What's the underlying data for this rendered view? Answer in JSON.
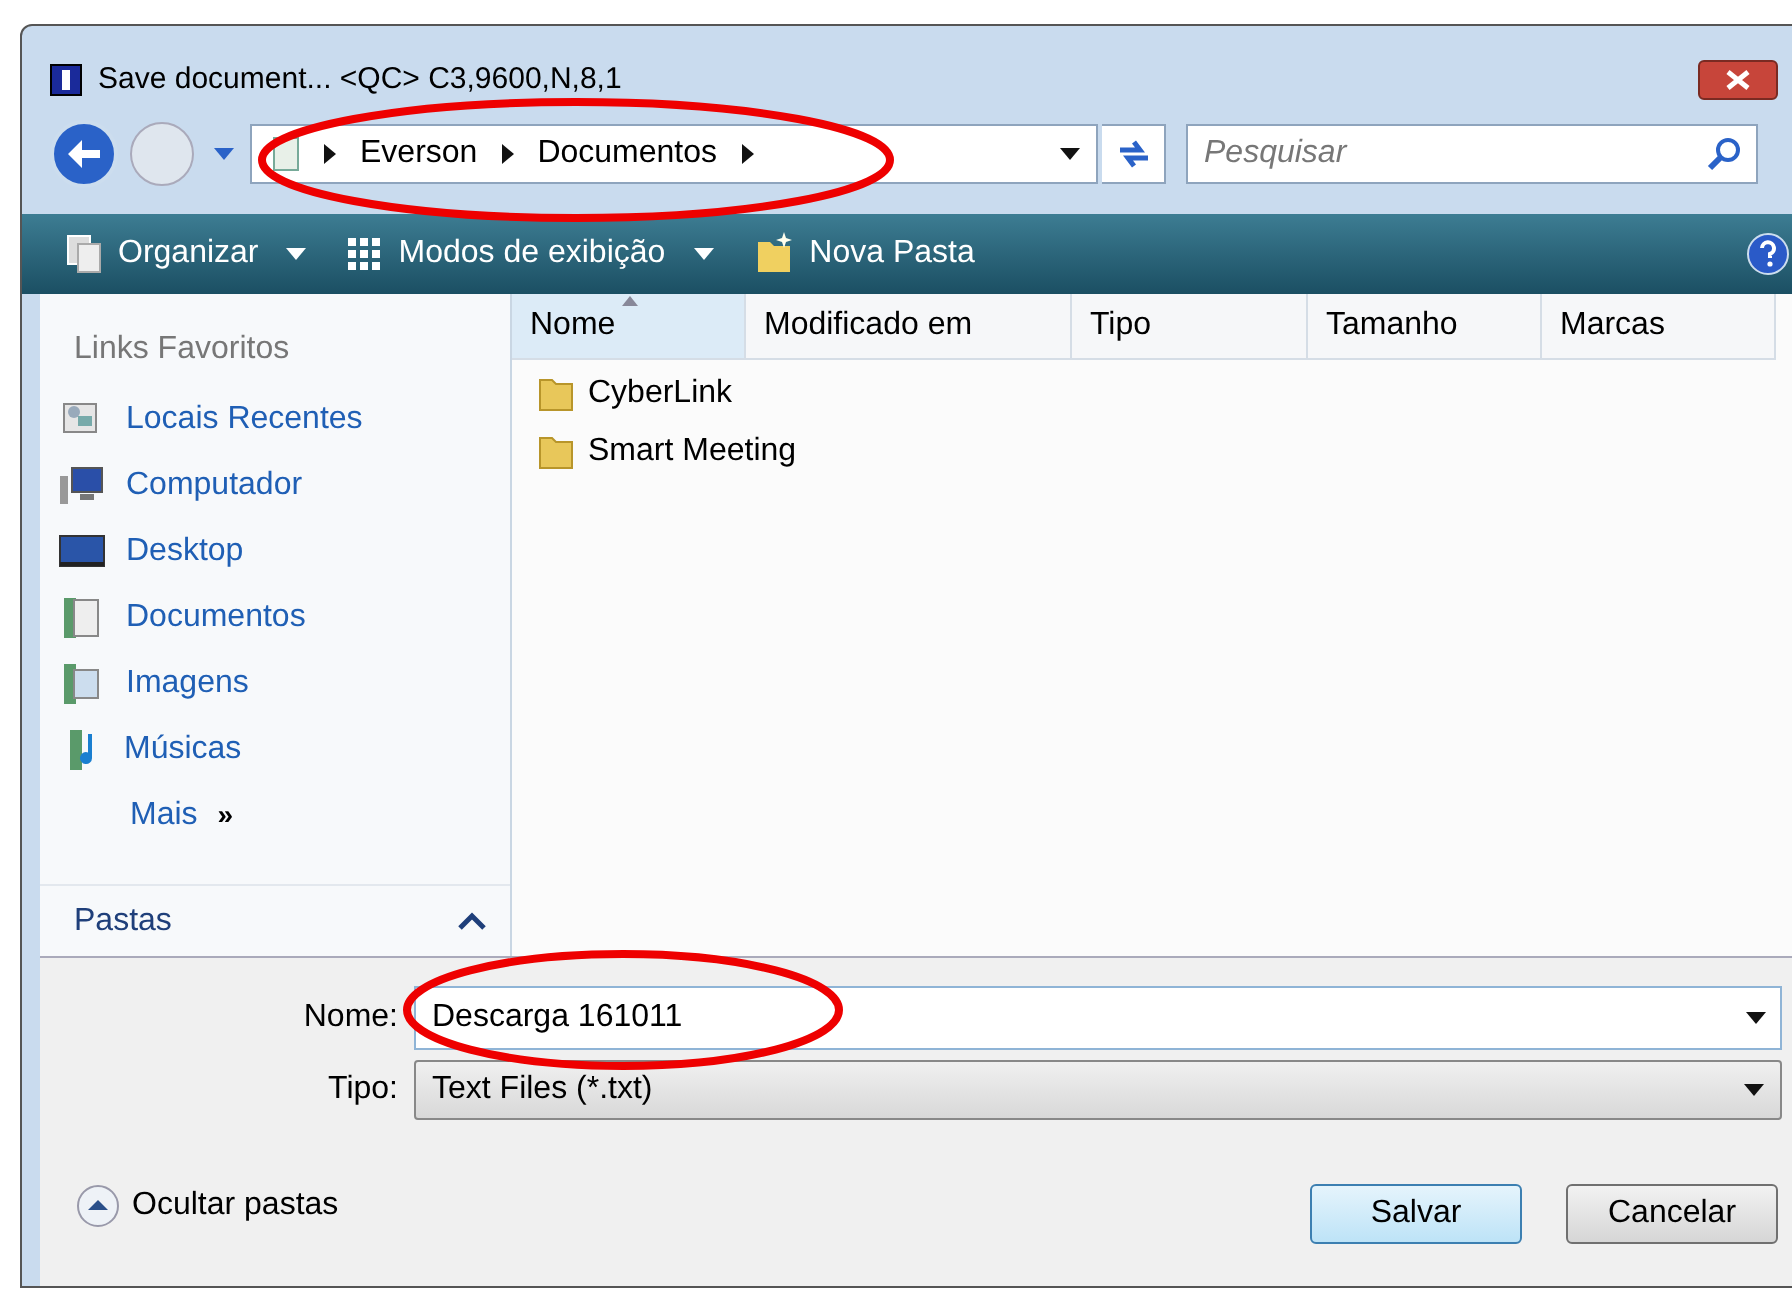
{
  "window": {
    "title": "Save document... <QC> C3,9600,N,8,1"
  },
  "address": {
    "crumbs": [
      "Everson",
      "Documentos"
    ]
  },
  "search": {
    "placeholder": "Pesquisar"
  },
  "toolbar": [
    "Organizar",
    "Modos de exibição",
    "Nova Pasta"
  ],
  "sidebar": {
    "heading": "Links Favoritos",
    "items": [
      {
        "label": "Locais Recentes",
        "kind": "recent"
      },
      {
        "label": "Computador",
        "kind": "computer"
      },
      {
        "label": "Desktop",
        "kind": "desktop"
      },
      {
        "label": "Documentos",
        "kind": "docs"
      },
      {
        "label": "Imagens",
        "kind": "pictures"
      },
      {
        "label": "Músicas",
        "kind": "music"
      }
    ],
    "more": "Mais",
    "more_icon": "»",
    "folders": "Pastas"
  },
  "table": {
    "columns": [
      {
        "label": "Nome",
        "selected": true
      },
      {
        "label": "Modificado em",
        "selected": false
      },
      {
        "label": "Tipo",
        "selected": false
      },
      {
        "label": "Tamanho",
        "selected": false
      },
      {
        "label": "Marcas",
        "selected": false
      }
    ],
    "rows": [
      "CyberLink",
      "Smart Meeting"
    ]
  },
  "form": {
    "name_label": "Nome:",
    "name_value": "Descarga 161011",
    "type_label": "Tipo:",
    "type_value": "Text Files (*.txt)"
  },
  "hide_folders": "Ocultar pastas",
  "buttons": [
    "Salvar",
    "Cancelar"
  ]
}
